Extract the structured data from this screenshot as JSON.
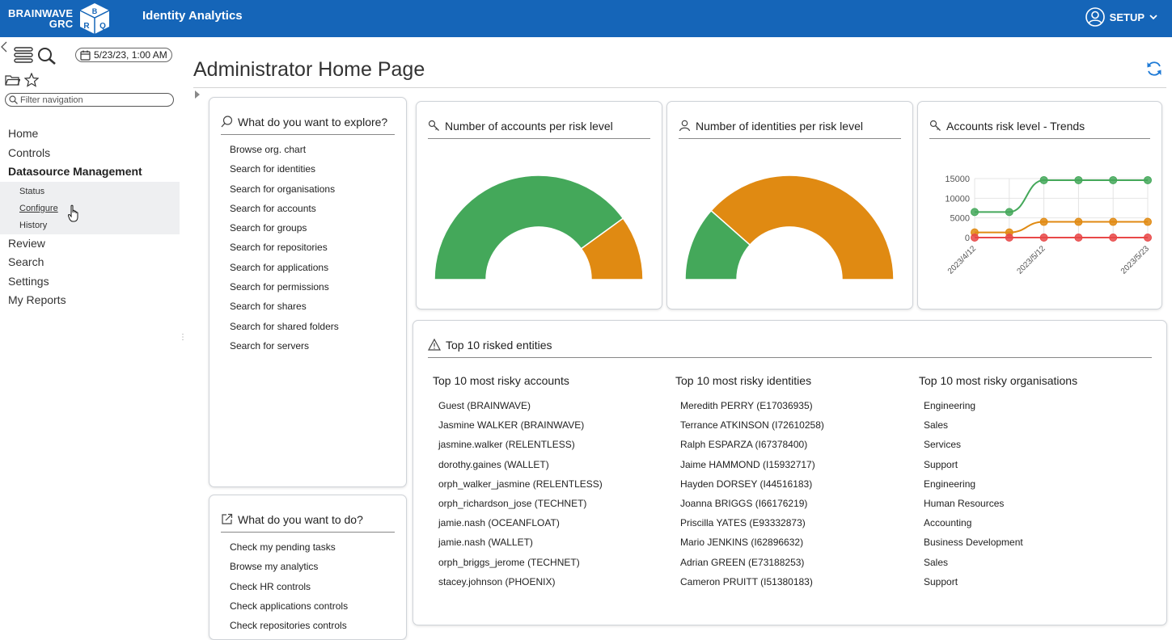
{
  "header": {
    "logo_line1": "BRAINWAVE",
    "logo_line2": "GRC",
    "logo_cube_letters": [
      "B",
      "R",
      "Q"
    ],
    "app_title": "Identity Analytics",
    "setup_label": "SETUP"
  },
  "sidebar": {
    "date": "5/23/23, 1:00 AM",
    "filter_placeholder": "Filter navigation",
    "items": [
      {
        "label": "Home"
      },
      {
        "label": "Controls"
      },
      {
        "label": "Datasource Management",
        "expanded": true,
        "children": [
          {
            "label": "Status"
          },
          {
            "label": "Configure"
          },
          {
            "label": "History"
          }
        ]
      },
      {
        "label": "Review"
      },
      {
        "label": "Search"
      },
      {
        "label": "Settings"
      },
      {
        "label": "My Reports"
      }
    ]
  },
  "main": {
    "title": "Administrator Home Page",
    "explore": {
      "title": "What do you want to explore?",
      "items": [
        "Browse org. chart",
        "Search for identities",
        "Search for organisations",
        "Search for accounts",
        "Search for groups",
        "Search for repositories",
        "Search for applications",
        "Search for permissions",
        "Search for shares",
        "Search for shared folders",
        "Search for servers"
      ]
    },
    "todo": {
      "title": "What do you want to do?",
      "items": [
        "Check my pending tasks",
        "Browse my analytics",
        "Check HR controls",
        "Check applications controls",
        "Check repositories controls"
      ]
    },
    "accounts_risk_title": "Number of accounts per risk level",
    "identities_risk_title": "Number of identities per risk level",
    "trends_title": "Accounts risk level - Trends",
    "top10": {
      "title": "Top 10 risked entities",
      "accounts_title": "Top 10 most risky accounts",
      "accounts": [
        "Guest (BRAINWAVE)",
        "Jasmine WALKER (BRAINWAVE)",
        "jasmine.walker (RELENTLESS)",
        "dorothy.gaines (WALLET)",
        "orph_walker_jasmine (RELENTLESS)",
        "orph_richardson_jose (TECHNET)",
        "jamie.nash (OCEANFLOAT)",
        "jamie.nash (WALLET)",
        "orph_briggs_jerome (TECHNET)",
        "stacey.johnson (PHOENIX)"
      ],
      "identities_title": "Top 10 most risky identities",
      "identities": [
        "Meredith PERRY (E17036935)",
        "Terrance ATKINSON (I72610258)",
        "Ralph ESPARZA (I67378400)",
        "Jaime HAMMOND (I15932717)",
        "Hayden DORSEY (I44516183)",
        "Joanna BRIGGS (I66176219)",
        "Priscilla YATES (E93332873)",
        "Mario JENKINS (I62896632)",
        "Adrian GREEN (E73188253)",
        "Cameron PRUITT (I51380183)"
      ],
      "orgs_title": "Top 10 most risky organisations",
      "orgs": [
        "Engineering",
        "Sales",
        "Services",
        "Support",
        "Engineering",
        "Human Resources",
        "Accounting",
        "Business Development",
        "Sales",
        "Support"
      ]
    }
  },
  "colors": {
    "header_bg": "#1565b8",
    "green": "#44a85a",
    "orange": "#e08a12",
    "red": "#e84848"
  },
  "chart_data": [
    {
      "type": "pie",
      "subtype": "half-donut",
      "title": "Number of accounts per risk level",
      "slices": [
        {
          "color": "#44a85a",
          "fraction": 0.8
        },
        {
          "color": "#e08a12",
          "fraction": 0.2
        }
      ]
    },
    {
      "type": "pie",
      "subtype": "half-donut",
      "title": "Number of identities per risk level",
      "slices": [
        {
          "color": "#44a85a",
          "fraction": 0.23
        },
        {
          "color": "#e08a12",
          "fraction": 0.77
        }
      ]
    },
    {
      "type": "line",
      "title": "Accounts risk level - Trends",
      "ylim": [
        0,
        15000
      ],
      "yticks": [
        0,
        5000,
        10000,
        15000
      ],
      "x_tick_labels": [
        "2023/4/12",
        "2023/5/12",
        "2023/5/23"
      ],
      "x_values": [
        0,
        1,
        2,
        3,
        4,
        5
      ],
      "grid": true,
      "series": [
        {
          "color": "#44a85a",
          "values": [
            6500,
            6500,
            14600,
            14600,
            14600,
            14600
          ]
        },
        {
          "color": "#e08a12",
          "values": [
            1300,
            1300,
            4000,
            4000,
            4000,
            4000
          ]
        },
        {
          "color": "#e84848",
          "values": [
            0,
            0,
            0,
            0,
            0,
            0
          ]
        }
      ]
    }
  ]
}
